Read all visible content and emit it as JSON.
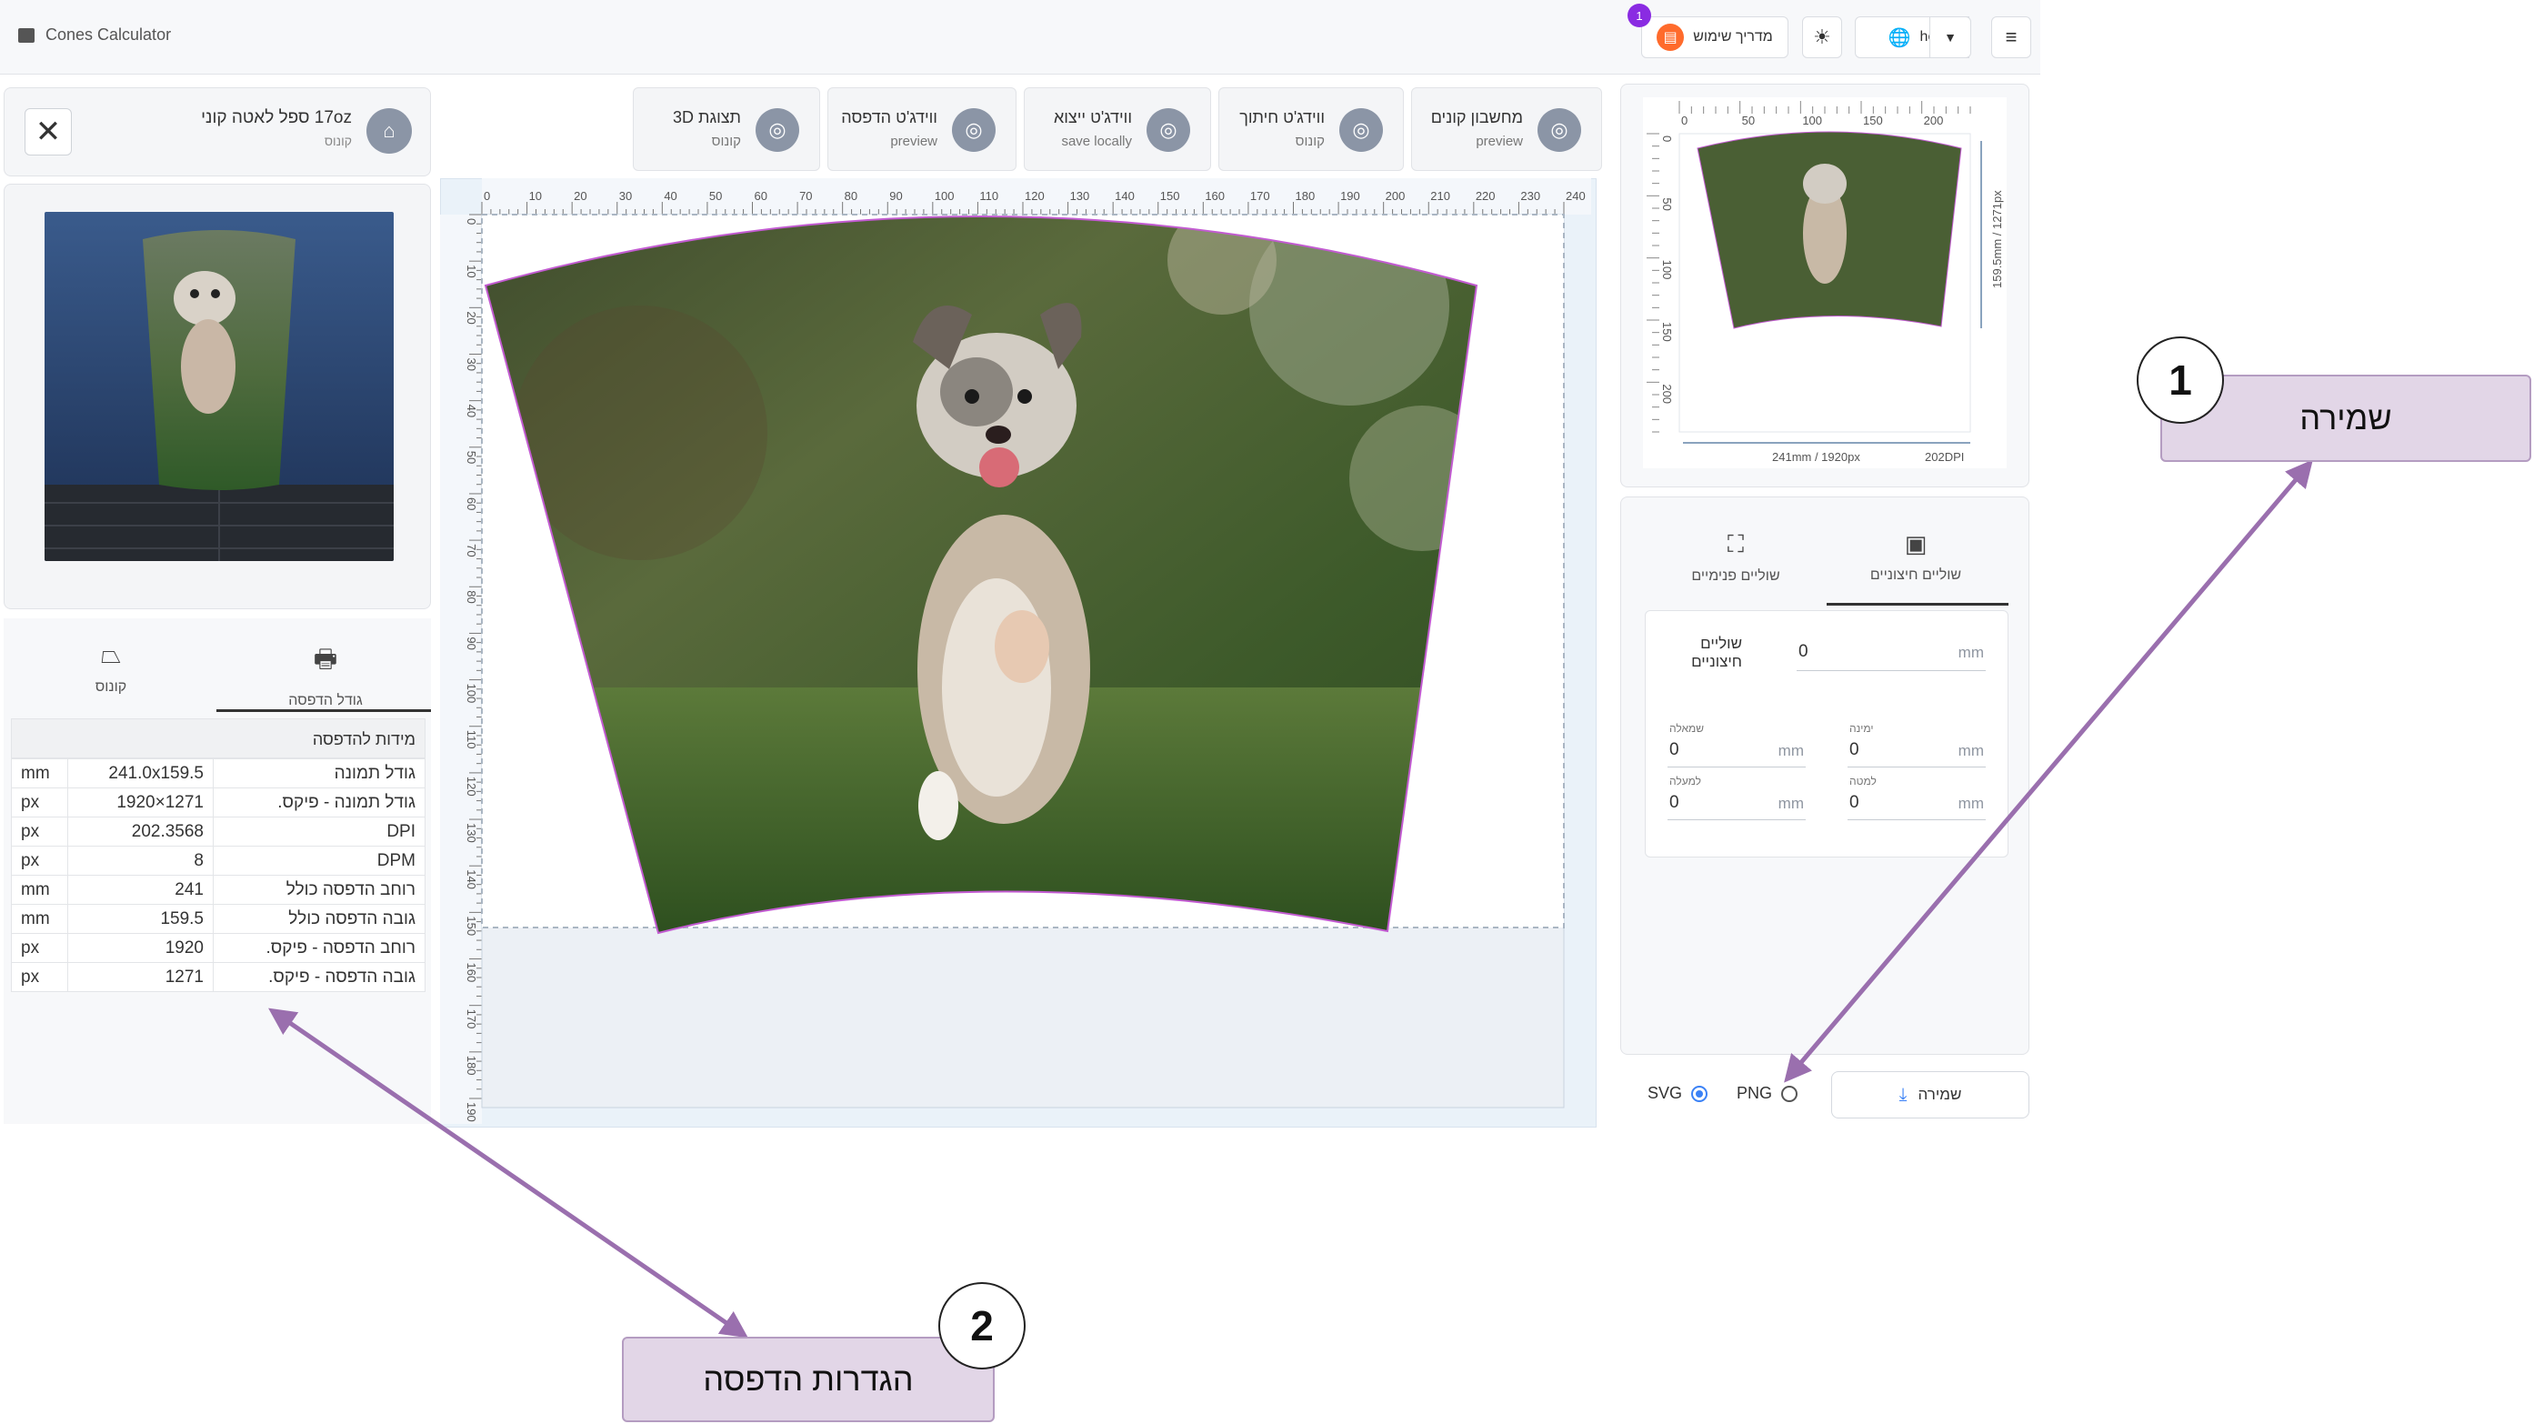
{
  "app": {
    "title": "Cones Calculator"
  },
  "topbar": {
    "guide_label": "מדריך שימוש",
    "guide_badge": "1",
    "lang_label": "he"
  },
  "product": {
    "name": "17oz ספל לאטה קוני",
    "subtitle": "קונוס"
  },
  "toolbar": [
    {
      "title": "מחשבון קונים",
      "subtitle": "preview",
      "icon": "cone-icon"
    },
    {
      "title": "ווידג'ט חיתוך",
      "subtitle": "קונוס",
      "icon": "crop-icon"
    },
    {
      "title": "ווידג'ט ייצוא",
      "subtitle": "save locally",
      "icon": "download-icon"
    },
    {
      "title": "ווידג'ט הדפסה",
      "subtitle": "preview",
      "icon": "printer-icon"
    },
    {
      "title": "תצוגת 3D",
      "subtitle": "קונוס",
      "icon": "cube-3d-icon"
    }
  ],
  "left_tabs": {
    "print_size": "גודל הדפסה",
    "cone": "קונוס"
  },
  "print_table": {
    "header": "מידות להדפסה",
    "rows": [
      {
        "label": "גודל תמונה",
        "value": "241.0x159.5",
        "unit": "mm"
      },
      {
        "label": "גודל תמונה - פיקס.",
        "value": "1920×1271",
        "unit": "px"
      },
      {
        "label": "DPI",
        "value": "202.3568",
        "unit": "px"
      },
      {
        "label": "DPM",
        "value": "8",
        "unit": "px"
      },
      {
        "label": "רוחב הדפסה כולל",
        "value": "241",
        "unit": "mm"
      },
      {
        "label": "גובה הדפסה כולל",
        "value": "159.5",
        "unit": "mm"
      },
      {
        "label": "רוחב הדפסה - פיקס.",
        "value": "1920",
        "unit": "px"
      },
      {
        "label": "גובה הדפסה - פיקס.",
        "value": "1271",
        "unit": "px"
      }
    ]
  },
  "ruler": {
    "h_ticks": [
      "0",
      "10",
      "20",
      "30",
      "40",
      "50",
      "60",
      "70",
      "80",
      "90",
      "100",
      "110",
      "120",
      "130",
      "140",
      "150",
      "160",
      "170",
      "180",
      "190",
      "200",
      "210",
      "220",
      "230",
      "240"
    ],
    "v_ticks": [
      "0",
      "10",
      "20",
      "30",
      "40",
      "50",
      "60",
      "70",
      "80",
      "90",
      "100",
      "110",
      "120",
      "130",
      "140",
      "150",
      "160",
      "170",
      "180",
      "190"
    ]
  },
  "preview": {
    "h_ticks": [
      "0",
      "50",
      "100",
      "150",
      "200"
    ],
    "v_ticks": [
      "0",
      "50",
      "100",
      "150",
      "200"
    ],
    "width_label": "241mm / 1920px",
    "dpi_label": "202DPI",
    "height_label": "159.5mm / 1271px"
  },
  "margins": {
    "tab_outer": "שוליים חיצוניים",
    "tab_inner": "שוליים פנימיים",
    "outer_label": "שוליים חיצוניים",
    "outer_value": "0",
    "unit": "mm",
    "left_label": "שמאלה",
    "left_value": "0",
    "right_label": "ימינה",
    "right_value": "0",
    "up_label": "למעלה",
    "up_value": "0",
    "down_label": "למטה",
    "down_value": "0"
  },
  "save": {
    "svg_label": "SVG",
    "png_label": "PNG",
    "selected": "SVG",
    "button_label": "שמירה"
  },
  "annotations": [
    {
      "num": "1",
      "text": "שמירה"
    },
    {
      "num": "2",
      "text": "הגדרות הדפסה"
    }
  ],
  "colors": {
    "accent": "#3b82f6",
    "annotation_fill": "#e2d6e7",
    "arrow": "#9a6fae",
    "badge": "#8a2be2",
    "guide": "#ff6b2c"
  }
}
